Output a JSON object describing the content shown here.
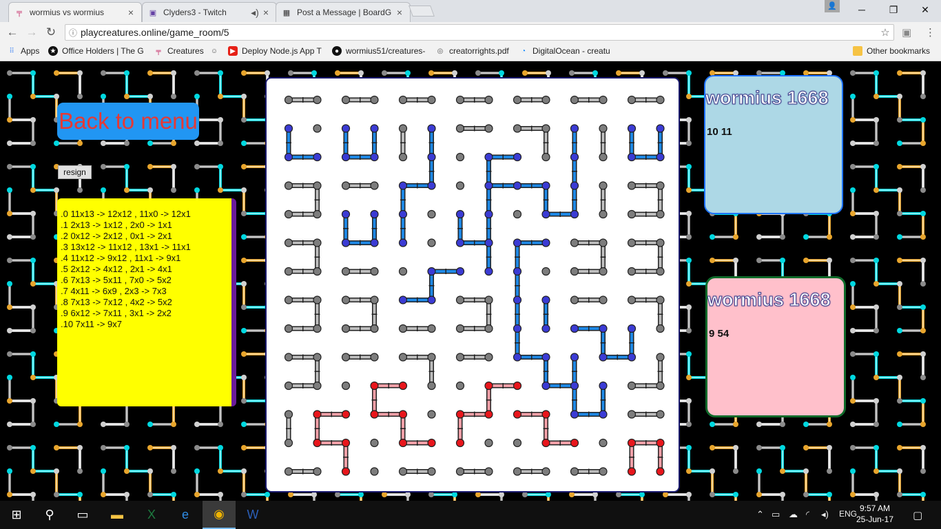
{
  "browser": {
    "tabs": [
      {
        "title": "wormius vs wormius",
        "active": true
      },
      {
        "title": "Clyders3 - Twitch",
        "active": false
      },
      {
        "title": "Post a Message | BoardG",
        "active": false
      }
    ],
    "url": "playcreatures.online/game_room/5",
    "bookmarks": [
      {
        "label": "Apps",
        "icon": "apps-grid-icon"
      },
      {
        "label": "Office Holders | The G",
        "icon": "star-badge-icon"
      },
      {
        "label": "Creatures",
        "icon": "creatures-icon"
      },
      {
        "label": "",
        "icon": "robot-icon"
      },
      {
        "label": "Deploy Node.js App T",
        "icon": "youtube-icon"
      },
      {
        "label": "wormius51/creatures-",
        "icon": "github-icon"
      },
      {
        "label": "creatorrights.pdf",
        "icon": "pdf-icon"
      },
      {
        "label": "DigitalOcean - creatu",
        "icon": "digitalocean-icon"
      }
    ],
    "other_bookmarks": "Other bookmarks"
  },
  "game": {
    "back_label": "Back to menu",
    "resign_label": "resign",
    "moves": [
      ".0 11x13 -> 12x12 , 11x0 -> 12x1",
      ".1 2x13 -> 1x12 , 2x0 -> 1x1",
      ".2 0x12 -> 2x12 , 0x1 -> 2x1",
      ".3 13x12 -> 11x12 , 13x1 -> 11x1",
      ".4 11x12 -> 9x12 , 11x1 -> 9x1",
      ".5 2x12 -> 4x12 , 2x1 -> 4x1",
      ".6 7x13 -> 5x11 , 7x0 -> 5x2",
      ".7 4x11 -> 6x9 , 2x3 -> 7x3",
      ".8 7x13 -> 7x12 , 4x2 -> 5x2",
      ".9 6x12 -> 7x11 , 3x1 -> 2x2",
      ".10 7x11 -> 9x7"
    ],
    "player_top": {
      "name": "wormius 1668",
      "info": "10 11"
    },
    "player_bottom": {
      "name": "wormius 1668",
      "info": "9 54"
    },
    "colors": {
      "blue_node": "#3b3bd4",
      "blue_link": "#1e88e5",
      "red_node": "#e8161c",
      "red_link": "#f4a0a8",
      "gray_node": "#7d7d7d",
      "gray_link": "#bdbdbd",
      "menu_button": "#2196f3",
      "moves_panel": "#ffff00"
    }
  },
  "taskbar": {
    "time": "9:57 AM",
    "date": "25-Jun-17",
    "language": "ENG"
  }
}
